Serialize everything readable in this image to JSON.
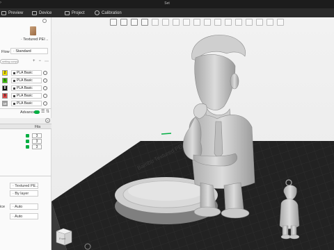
{
  "window": {
    "title": "Set",
    "hint": "›"
  },
  "nav": {
    "tabs": [
      {
        "label": "Preview",
        "icon": "preview-icon"
      },
      {
        "label": "Device",
        "icon": "device-icon"
      },
      {
        "label": "Project",
        "icon": "project-icon"
      },
      {
        "label": "Calibration",
        "icon": "calibration-icon"
      }
    ]
  },
  "left_panel": {
    "plate_label": "· Textured PEI ..",
    "flow_label": "Flow",
    "flow_value": "· Standard",
    "setting_pill": "setting complete",
    "filament_tools": [
      "+",
      "−",
      "⋯"
    ],
    "filaments": [
      {
        "num": "2",
        "color": "#f2e300",
        "name": "PLA Basic"
      },
      {
        "num": "5",
        "color": "#38c000",
        "name": "PLA Basic"
      },
      {
        "num": "8",
        "color": "#111111",
        "name": "PLA Basic"
      },
      {
        "num": "9",
        "color": "#e34848",
        "name": "PLA Basic"
      },
      {
        "num": "10",
        "color": "#9a9a9a",
        "name": "PLA Basic"
      }
    ],
    "advanced_label": "Advanced",
    "objects": {
      "column_header": "Fila",
      "rows": [
        {
          "value": "3"
        },
        {
          "value": "3"
        },
        {
          "value": "3"
        }
      ]
    },
    "properties": {
      "plate_type": "· Textured PE..",
      "seq": "· By layer",
      "slice_label": "ice",
      "auto_1": "· Auto",
      "auto_2": "· Auto"
    }
  },
  "viewport": {
    "bed_text": "Bambu Textured PEI Plate",
    "nav_cube_label": "Front",
    "accent": "#00ae42"
  }
}
